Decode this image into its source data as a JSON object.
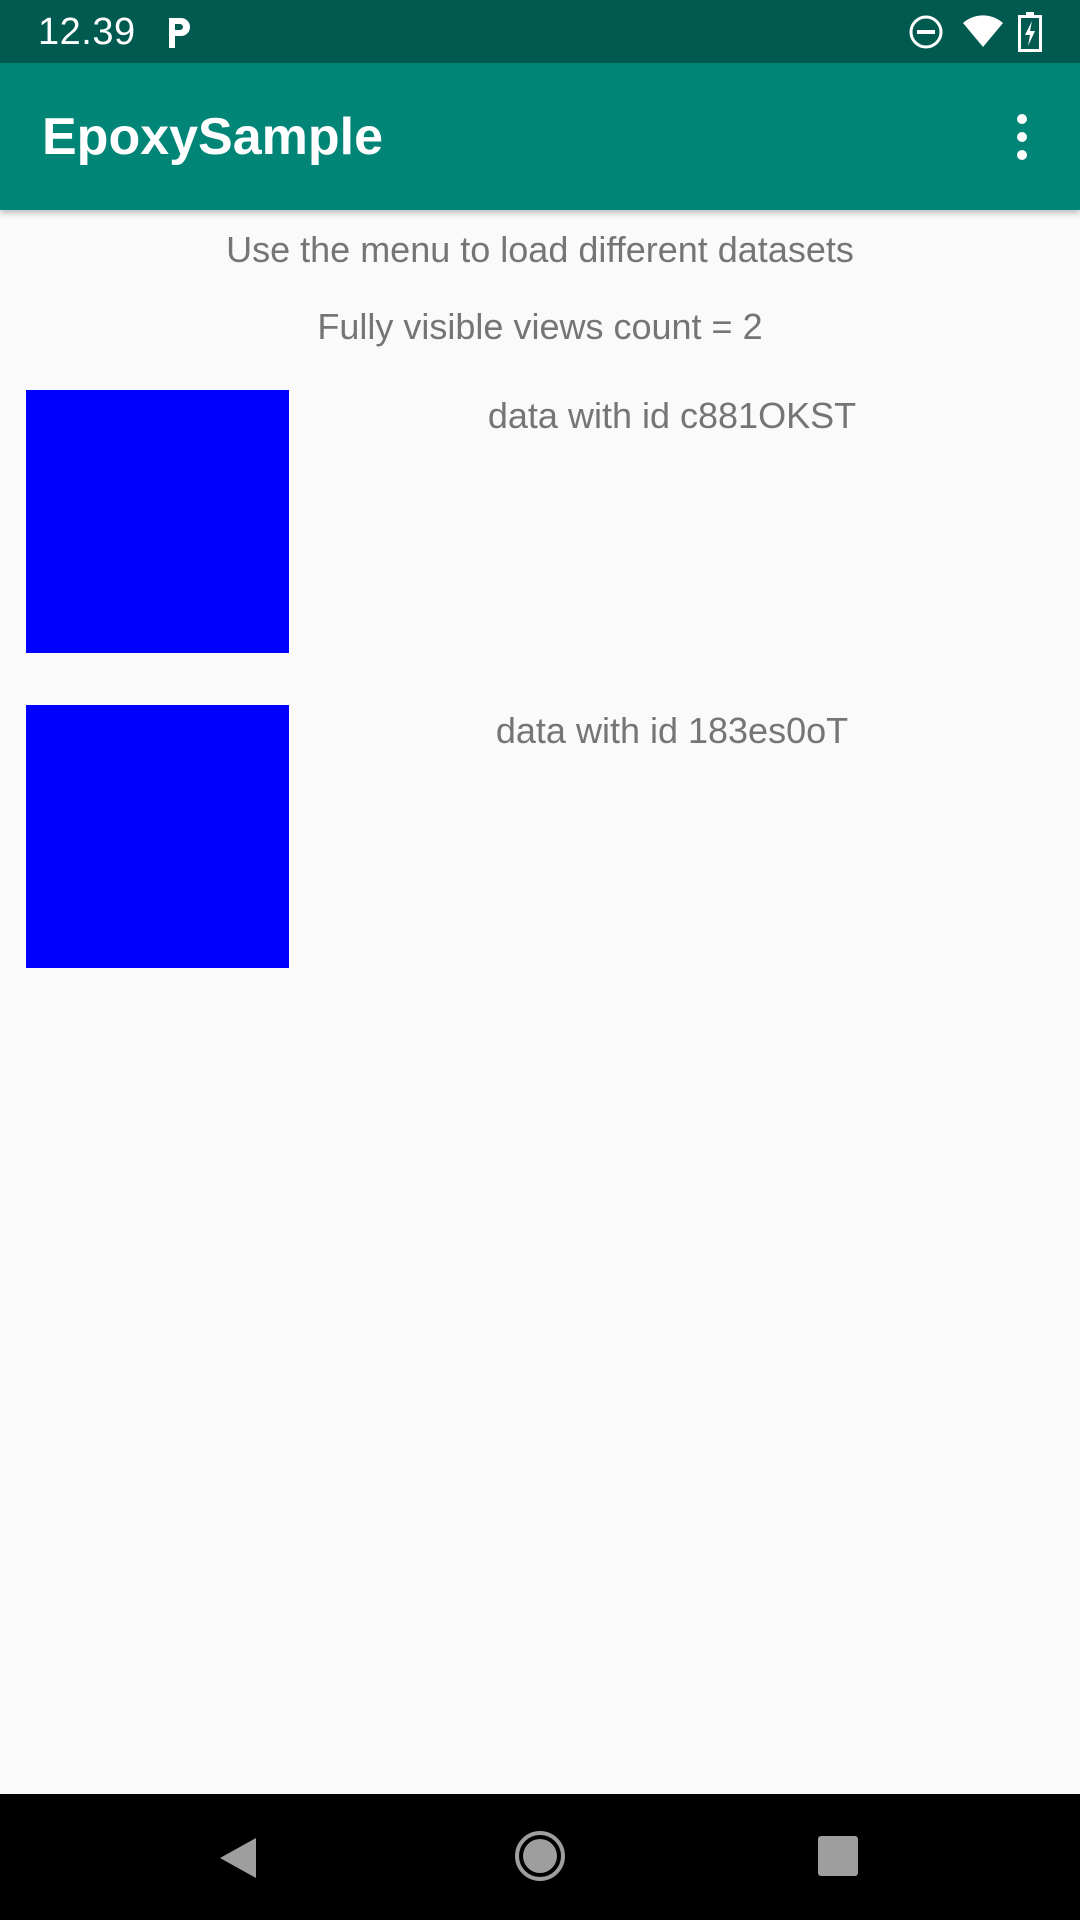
{
  "status_bar": {
    "time": "12.39",
    "icons": [
      "parking-notification-icon",
      "do-not-disturb-icon",
      "wifi-icon",
      "battery-charging-icon"
    ],
    "background": "#005a4f"
  },
  "app_bar": {
    "title": "EpoxySample",
    "overflow_icon": "more-vert-icon",
    "background": "#008577"
  },
  "content": {
    "instruction": "Use the menu to load different datasets",
    "visible_count": "Fully visible views count = 2",
    "items": [
      {
        "label": "data with id c881OKST",
        "color": "#0000ff"
      },
      {
        "label": "data with id 183es0oT",
        "color": "#0000ff"
      }
    ]
  },
  "nav_bar": {
    "icons": [
      "back-icon",
      "home-icon",
      "recents-icon"
    ]
  }
}
